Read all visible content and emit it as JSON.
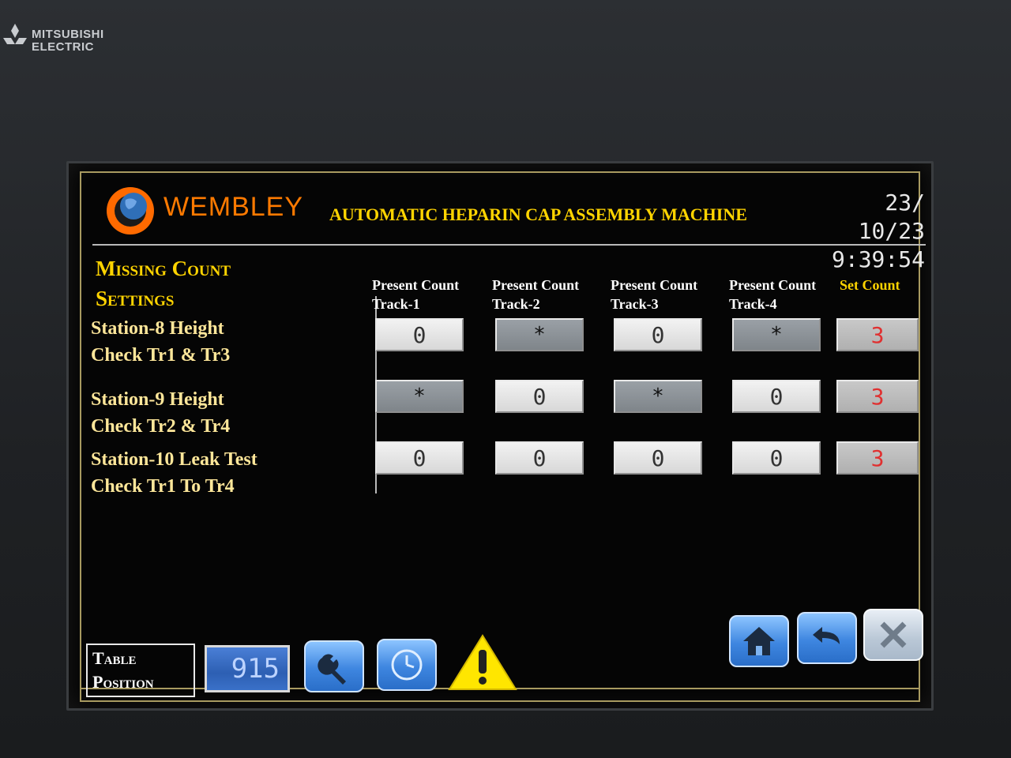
{
  "bezel": {
    "brand_line1": "MITSUBISHI",
    "brand_line2": "ELECTRIC"
  },
  "header": {
    "logo_text": "WEMBLEY",
    "title": "AUTOMATIC HEPARIN CAP ASSEMBLY MACHINE",
    "date": "23/ 10/23",
    "time": "9:39:54"
  },
  "section": {
    "title_line1": "Missing Count",
    "title_line2": "Settings"
  },
  "stations": [
    {
      "line1": "Station-8 Height",
      "line2": "Check Tr1 & Tr3"
    },
    {
      "line1": "Station-9 Height",
      "line2": "Check Tr2 & Tr4"
    },
    {
      "line1": "Station-10 Leak Test",
      "line2": "Check Tr1 To Tr4"
    }
  ],
  "columns": [
    {
      "line1": "Present Count",
      "line2": "Track-1"
    },
    {
      "line1": "Present Count",
      "line2": "Track-2"
    },
    {
      "line1": "Present Count",
      "line2": "Track-3"
    },
    {
      "line1": "Present Count",
      "line2": "Track-4"
    },
    {
      "line1": "Set Count",
      "line2": ""
    }
  ],
  "rows": [
    [
      "0",
      "*",
      "0",
      "*",
      "3"
    ],
    [
      "*",
      "0",
      "*",
      "0",
      "3"
    ],
    [
      "0",
      "0",
      "0",
      "0",
      "3"
    ]
  ],
  "footer": {
    "table_label_line1": "Table",
    "table_label_line2": "Position",
    "table_position": "915"
  },
  "icons": {
    "settings": "wrench-icon",
    "timer": "clock-icon",
    "alarm": "warning-icon",
    "home": "home-icon",
    "back": "back-arrow-icon",
    "close": "close-icon"
  },
  "colors": {
    "title_yellow": "#ffd400",
    "station_text": "#ffe79a",
    "set_count_red": "#e03030",
    "button_blue": "#3e86e0"
  }
}
